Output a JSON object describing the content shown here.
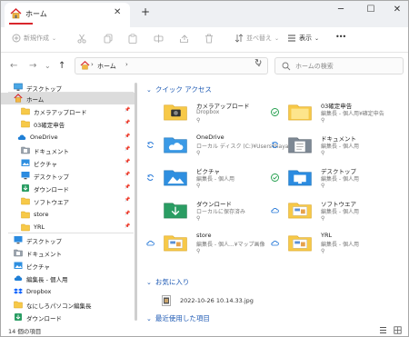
{
  "window": {
    "tab_title": "ホーム",
    "new_tab": "+",
    "close_tab": "✕",
    "minimize": "─",
    "maximize": "☐",
    "close": "✕"
  },
  "toolbar": {
    "new_label": "新規作成",
    "sort_label": "並べ替え",
    "view_label": "表示",
    "more_label": "•••"
  },
  "address": {
    "path": "ホーム",
    "search_placeholder": "ホームの検索"
  },
  "sidebar": {
    "items": [
      {
        "label": "デスクトップ",
        "icon": "desktop-icon",
        "pin": false
      },
      {
        "label": "ホーム",
        "icon": "home-icon",
        "pin": false,
        "selected": true
      },
      {
        "label": "カメラアップロード",
        "icon": "folder-icon",
        "pin": true
      },
      {
        "label": "03確定申告",
        "icon": "folder-icon",
        "pin": true
      },
      {
        "label": "OneDrive",
        "icon": "cloud-icon",
        "pin": true
      },
      {
        "label": "ドキュメント",
        "icon": "document-folder-icon",
        "pin": true
      },
      {
        "label": "ピクチャ",
        "icon": "pictures-folder-icon",
        "pin": true
      },
      {
        "label": "デスクトップ",
        "icon": "desktop-folder-icon",
        "pin": true
      },
      {
        "label": "ダウンロード",
        "icon": "download-folder-icon",
        "pin": true
      },
      {
        "label": "ソフトウエア",
        "icon": "folder-icon",
        "pin": true
      },
      {
        "label": "store",
        "icon": "folder-icon",
        "pin": true
      },
      {
        "label": "YRL",
        "icon": "folder-icon",
        "pin": true
      },
      {
        "label": "デスクトップ",
        "icon": "desktop-folder-icon",
        "pin": false
      },
      {
        "label": "ドキュメント",
        "icon": "document-folder-icon",
        "pin": false
      },
      {
        "label": "ピクチャ",
        "icon": "pictures-folder-icon",
        "pin": false
      },
      {
        "label": "編集長 - 個人用",
        "icon": "cloud-icon",
        "pin": false
      },
      {
        "label": "Dropbox",
        "icon": "dropbox-icon",
        "pin": false
      },
      {
        "label": "なにしろパソコン編集長",
        "icon": "folder-icon",
        "pin": false
      },
      {
        "label": "ダウンロード",
        "icon": "download-folder-icon",
        "pin": false
      }
    ]
  },
  "main": {
    "quick_access_header": "クイック アクセス",
    "favorites_header": "お気に入り",
    "recent_header": "最近使用した項目",
    "quick_access": [
      {
        "name": "カメラアップロード",
        "sub": "Dropbox",
        "sync": "none",
        "type": "camera"
      },
      {
        "name": "03確定申告",
        "sub": "編集長 - 個人用¥確定申告",
        "sync": "green-check",
        "type": "folder"
      },
      {
        "name": "OneDrive",
        "sub": "ローカル ディスク (C:)¥Users¥hayas",
        "sync": "sync",
        "type": "onedrive"
      },
      {
        "name": "ドキュメント",
        "sub": "編集長 - 個人用",
        "sync": "sync",
        "type": "documents"
      },
      {
        "name": "ピクチャ",
        "sub": "編集長 - 個人用",
        "sync": "sync",
        "type": "pictures"
      },
      {
        "name": "デスクトップ",
        "sub": "編集長 - 個人用",
        "sync": "green-check",
        "type": "desktop"
      },
      {
        "name": "ダウンロード",
        "sub": "ローカルに保存済み",
        "sync": "none",
        "type": "download"
      },
      {
        "name": "ソフトウエア",
        "sub": "編集長 - 個人用",
        "sync": "cloud",
        "type": "thumb"
      },
      {
        "name": "store",
        "sub": "編集長 - 個人...¥マップ画像",
        "sync": "cloud",
        "type": "thumb"
      },
      {
        "name": "YRL",
        "sub": "編集長 - 個人用",
        "sync": "cloud",
        "type": "thumb"
      }
    ],
    "favorites": [
      {
        "name": "2022-10-26 10.14.33.jpg"
      }
    ]
  },
  "status": {
    "count": "14 個の項目"
  }
}
